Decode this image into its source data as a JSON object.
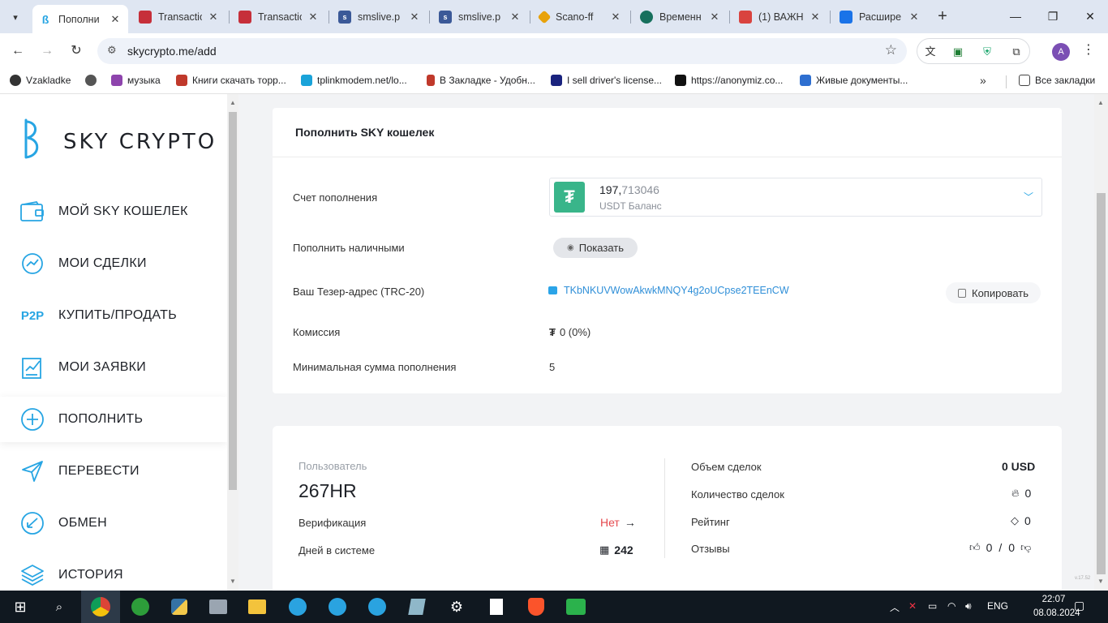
{
  "browser": {
    "tabs": [
      {
        "label": "Пополни",
        "favicon_color": "#27a5e3",
        "icon": "sky-crypto-icon",
        "active": true
      },
      {
        "label": "Transactio",
        "favicon_color": "#c62f3a",
        "icon": "cube-icon"
      },
      {
        "label": "Transactio",
        "favicon_color": "#c62f3a",
        "icon": "cube-icon"
      },
      {
        "label": "smslive.p",
        "favicon_color": "#3b5998",
        "icon": "sms-icon"
      },
      {
        "label": "smslive.p",
        "favicon_color": "#3b5998",
        "icon": "sms-icon"
      },
      {
        "label": "Scano-ff",
        "favicon_color": "#e8a20b",
        "icon": "binance-icon"
      },
      {
        "label": "Временн",
        "favicon_color": "#17705d",
        "icon": "globe-icon"
      },
      {
        "label": "(1) ВАЖН",
        "favicon_color": "#d9433f",
        "icon": "mail-icon"
      },
      {
        "label": "Расшире",
        "favicon_color": "#1a73e8",
        "icon": "puzzle-icon"
      }
    ],
    "url": "skycrypto.me/add",
    "profile_initial": "A",
    "bookmarks": [
      {
        "label": "Vzakladke",
        "color": "#333"
      },
      {
        "label": "",
        "color": "#333"
      },
      {
        "label": "музыка",
        "color": "#8e44ad"
      },
      {
        "label": "Книги скачать торр...",
        "color": "#c0392b"
      },
      {
        "label": "tplinkmodem.net/lo...",
        "color": "#1aa3d9"
      },
      {
        "label": "В Закладке - Удобн...",
        "color": "#c0392b"
      },
      {
        "label": "I sell driver's license...",
        "color": "#1a237e"
      },
      {
        "label": "https://anonymiz.co...",
        "color": "#111"
      },
      {
        "label": "Живые документы...",
        "color": "#2e6fd0"
      }
    ],
    "all_bookmarks": "Все закладки"
  },
  "sidebar": {
    "logo": "SKY CRYPTO",
    "items": [
      {
        "label": "МОЙ SKY КОШЕЛЕК",
        "icon": "wallet-icon"
      },
      {
        "label": "МОИ СДЕЛКИ",
        "icon": "deals-icon"
      },
      {
        "label": "КУПИТЬ/ПРОДАТЬ",
        "icon": "p2p-icon",
        "icon_text": "P2P"
      },
      {
        "label": "МОИ ЗАЯВКИ",
        "icon": "chart-doc-icon"
      },
      {
        "label": "ПОПОЛНИТЬ",
        "icon": "plus-circle-icon",
        "active": true
      },
      {
        "label": "ПЕРЕВЕСТИ",
        "icon": "send-icon"
      },
      {
        "label": "ОБМЕН",
        "icon": "exchange-icon"
      },
      {
        "label": "ИСТОРИЯ",
        "icon": "layers-icon"
      }
    ]
  },
  "deposit": {
    "title": "Пополнить SKY кошелек",
    "account_label": "Счет пополнения",
    "balance_int": "197,",
    "balance_frac": "713046",
    "balance_sub": "USDT Баланс",
    "cash_label": "Пополнить наличными",
    "show_label": "Показать",
    "address_label": "Ваш Тезер-адрес (TRC-20)",
    "address": "TKbNKUVWowAkwkMNQY4g2oUCpse2TEEnCW",
    "copy_label": "Копировать",
    "fee_label": "Комиссия",
    "fee_symbol": "₮",
    "fee_value": "0 (0%)",
    "min_label": "Минимальная сумма пополнения",
    "min_value": "5"
  },
  "profile": {
    "user_label": "Пользователь",
    "username": "267HR",
    "verification_label": "Верификация",
    "verification_value": "Нет",
    "days_label": "Дней в системе",
    "days_value": "242",
    "volume_label": "Объем сделок",
    "volume_value": "0 USD",
    "deals_label": "Количество сделок",
    "deals_value": "0",
    "rating_label": "Рейтинг",
    "rating_value": "0",
    "reviews_label": "Отзывы",
    "reviews_pos": "0",
    "reviews_sep": "/",
    "reviews_neg": "0",
    "version": "v.17.52"
  },
  "taskbar": {
    "lang": "ENG",
    "time": "22:07",
    "date": "08.08.2024"
  }
}
